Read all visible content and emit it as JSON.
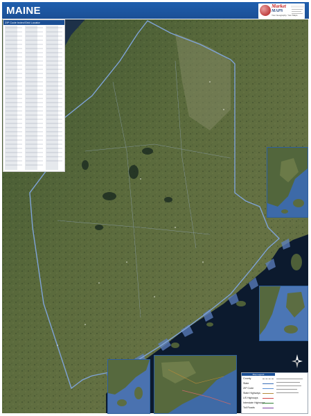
{
  "header": {
    "title": "MAINE",
    "brand_accent": "#1b4f95",
    "logo": {
      "name_line1": "Market",
      "name_line2": "MAPS",
      "tagline": "Your Geography. Your Maps."
    }
  },
  "zip_index": {
    "heading": "ZIP Code Index/Grid Locator"
  },
  "legend": {
    "heading": "Map Legend",
    "items": [
      {
        "label": "County",
        "color": "#8a8a8a",
        "icon": "dashed-line"
      },
      {
        "label": "State",
        "color": "#3a6fb8",
        "icon": "solid-line"
      },
      {
        "label": "ZIP Code",
        "color": "#5a8fd4",
        "icon": "thin-line"
      },
      {
        "label": "State Highways",
        "color": "#b58a3a",
        "icon": "solid-line"
      },
      {
        "label": "US Highways",
        "color": "#d04040",
        "icon": "solid-line"
      },
      {
        "label": "Interstate Highways",
        "color": "#2e7d32",
        "icon": "solid-line"
      },
      {
        "label": "Toll Roads",
        "color": "#7a3fa0",
        "icon": "solid-line"
      }
    ]
  },
  "colors": {
    "ocean": "#0c1a2e",
    "land": "#55653a",
    "boundary": "#7fa3d8",
    "water_highlight": "#5d80c0"
  },
  "icons": {
    "north_arrow": "compass-icon",
    "logo": "globe-logo-icon"
  }
}
